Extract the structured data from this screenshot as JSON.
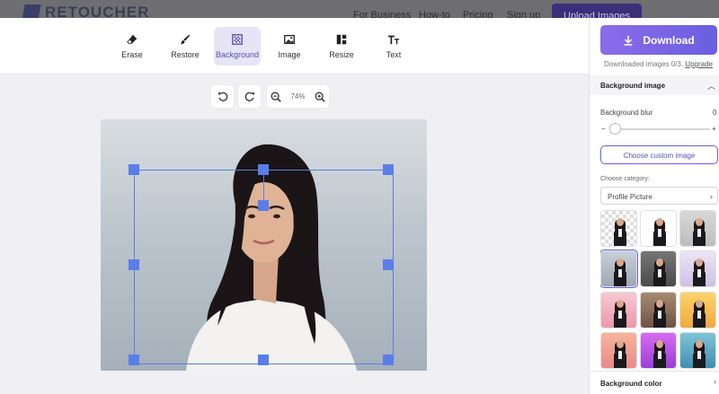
{
  "topnav": {
    "brand": "RETOUCHER",
    "links": [
      "For Business",
      "How-to",
      "Pricing",
      "Sign up"
    ],
    "upload_label": "Upload Images"
  },
  "toolbar": {
    "tools": [
      {
        "label": "Erase",
        "icon": "eraser-icon"
      },
      {
        "label": "Restore",
        "icon": "brush-icon"
      },
      {
        "label": "Background",
        "icon": "background-icon",
        "active": true
      },
      {
        "label": "Image",
        "icon": "image-icon"
      },
      {
        "label": "Resize",
        "icon": "resize-icon"
      },
      {
        "label": "Text",
        "icon": "text-icon"
      }
    ]
  },
  "canvas": {
    "zoom": "74%"
  },
  "panel": {
    "download_label": "Download",
    "downloaded_note": "Downloaded images 0/3.",
    "upgrade_link": "Upgrade",
    "background_image_title": "Background image",
    "blur_label": "Background blur",
    "blur_value": "0",
    "slider_min": "−",
    "slider_max": "+",
    "custom_image_button": "Choose custom image",
    "category_label": "Choose category:",
    "category_value": "Profile Picture",
    "background_color_title": "Background color"
  },
  "colors": {
    "accent": "#6a5fe0",
    "selection": "#5a7de8"
  }
}
